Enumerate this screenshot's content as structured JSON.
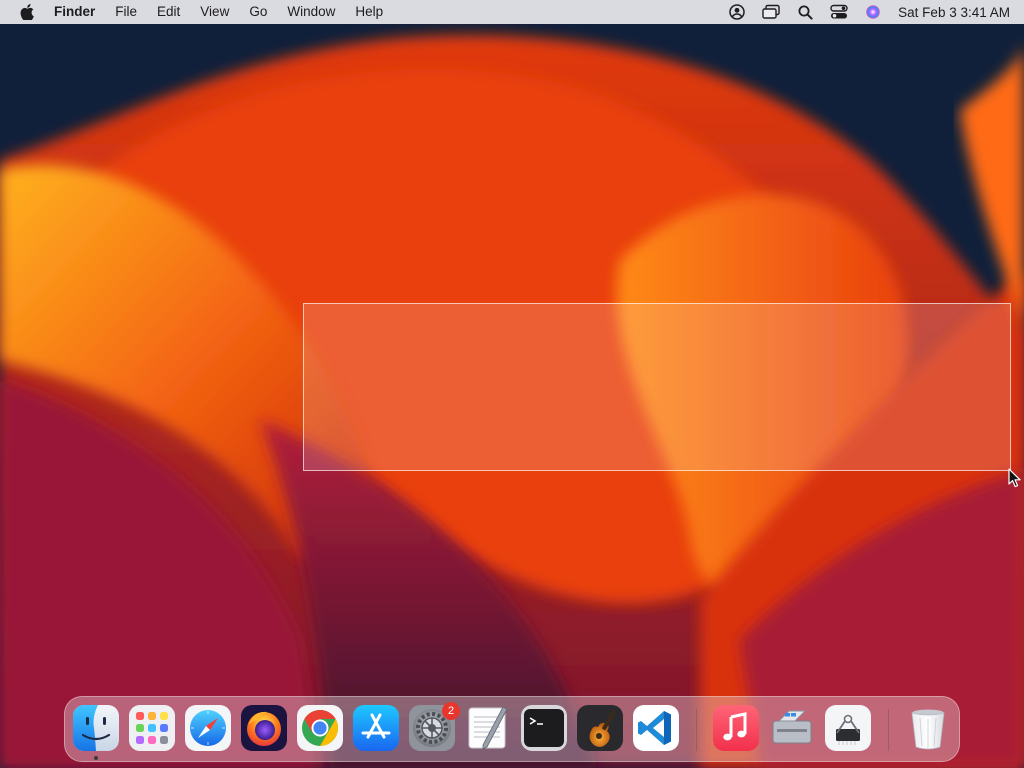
{
  "menubar": {
    "apple_icon": "apple-logo-icon",
    "app_name": "Finder",
    "menus": [
      "File",
      "Edit",
      "View",
      "Go",
      "Window",
      "Help"
    ],
    "status_icons": [
      "user-account-icon",
      "screen-mirroring-icon",
      "spotlight-search-icon",
      "control-center-icon",
      "siri-icon"
    ],
    "clock": "Sat Feb 3  3:41 AM"
  },
  "dock": {
    "items": [
      {
        "name": "Finder",
        "icon": "finder-icon",
        "running": true
      },
      {
        "name": "Launchpad",
        "icon": "launchpad-icon"
      },
      {
        "name": "Safari",
        "icon": "safari-icon"
      },
      {
        "name": "Firefox",
        "icon": "firefox-icon"
      },
      {
        "name": "Google Chrome",
        "icon": "chrome-icon"
      },
      {
        "name": "App Store",
        "icon": "app-store-icon"
      },
      {
        "name": "System Settings",
        "icon": "system-settings-icon",
        "badge": "2"
      },
      {
        "name": "TextEdit",
        "icon": "textedit-icon"
      },
      {
        "name": "Terminal",
        "icon": "terminal-icon"
      },
      {
        "name": "GarageBand",
        "icon": "garageband-icon"
      },
      {
        "name": "Visual Studio Code",
        "icon": "vscode-icon"
      },
      {
        "name": "Music",
        "icon": "music-icon"
      },
      {
        "name": "Boot Camp Assistant",
        "icon": "boot-camp-icon"
      },
      {
        "name": "System Information",
        "icon": "system-information-icon"
      },
      {
        "name": "Trash",
        "icon": "trash-icon"
      }
    ]
  },
  "colors": {
    "menubar_bg": "#ececf0",
    "badge": "#e8362e",
    "accent_orange": "#f24a10"
  }
}
